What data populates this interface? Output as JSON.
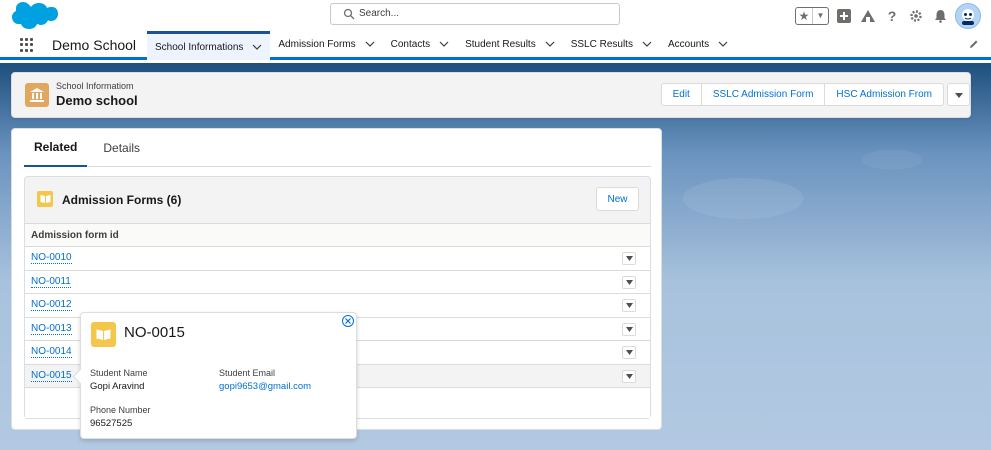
{
  "search": {
    "placeholder": "Search..."
  },
  "app": {
    "name": "Demo School"
  },
  "nav": {
    "items": [
      {
        "label": "School Informations",
        "active": true
      },
      {
        "label": "Admission Forms"
      },
      {
        "label": "Contacts"
      },
      {
        "label": "Student Results"
      },
      {
        "label": "SSLC Results"
      },
      {
        "label": "Accounts"
      }
    ]
  },
  "record": {
    "type": "School Informatiom",
    "name": "Demo school",
    "actions": [
      "Edit",
      "SSLC Admission Form",
      "HSC Admission From"
    ]
  },
  "tabs": [
    "Related",
    "Details"
  ],
  "related": {
    "title": "Admission Forms (6)",
    "new_label": "New",
    "column_header": "Admission form id",
    "rows": [
      "NO-0010",
      "NO-0011",
      "NO-0012",
      "NO-0013",
      "NO-0014",
      "NO-0015"
    ]
  },
  "popover": {
    "title": "NO-0015",
    "fields": {
      "student_name_label": "Student Name",
      "student_name": "Gopi Aravind",
      "student_email_label": "Student Email",
      "student_email": "gopi9653@gmail.com",
      "phone_label": "Phone Number",
      "phone": "96527525"
    }
  },
  "colors": {
    "brand_blue": "#0070d2",
    "record_icon": "#e2a75f",
    "related_icon": "#f4c64c"
  }
}
